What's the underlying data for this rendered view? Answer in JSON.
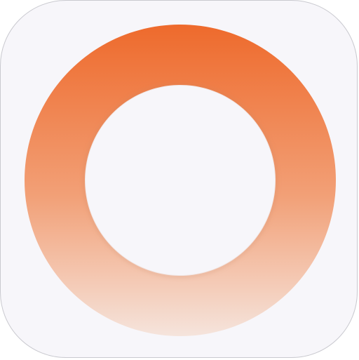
{
  "app_icon": {
    "icon": "ring-icon",
    "colors": {
      "tile_background": "#f7f6fa",
      "tile_border": "#c9c9cf",
      "ring_top": "#ee6a2c",
      "ring_bottom": "#f5e4dc",
      "center": "#f7f6fa"
    }
  }
}
